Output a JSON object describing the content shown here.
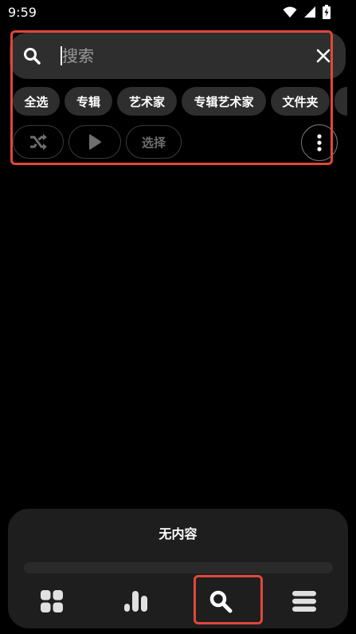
{
  "status_bar": {
    "time": "9:59",
    "icons": [
      "wifi-icon",
      "cellular-signal-icon",
      "battery-charging-icon"
    ]
  },
  "search": {
    "placeholder": "搜索",
    "value": "",
    "icons": {
      "leading": "search-icon",
      "trailing": "close-icon"
    }
  },
  "filters": [
    {
      "label": "全选"
    },
    {
      "label": "专辑"
    },
    {
      "label": "艺术家"
    },
    {
      "label": "专辑艺术家"
    },
    {
      "label": "文件夹"
    }
  ],
  "actions": {
    "shuffle_icon": "shuffle-icon",
    "play_icon": "play-icon",
    "select_label": "选择",
    "more_icon": "more-vertical-icon"
  },
  "player": {
    "status_text": "无内容",
    "progress": 0
  },
  "bottom_nav": [
    {
      "icon": "grid-icon",
      "active": false
    },
    {
      "icon": "bar-chart-icon",
      "active": false
    },
    {
      "icon": "search-icon",
      "active": true
    },
    {
      "icon": "list-icon",
      "active": false
    }
  ],
  "colors": {
    "background": "#000000",
    "surface": "#2e2e2e",
    "panel": "#1e1e1e",
    "text": "#ffffff",
    "disabled": "#6e6e6e",
    "highlight": "#e0473b"
  }
}
